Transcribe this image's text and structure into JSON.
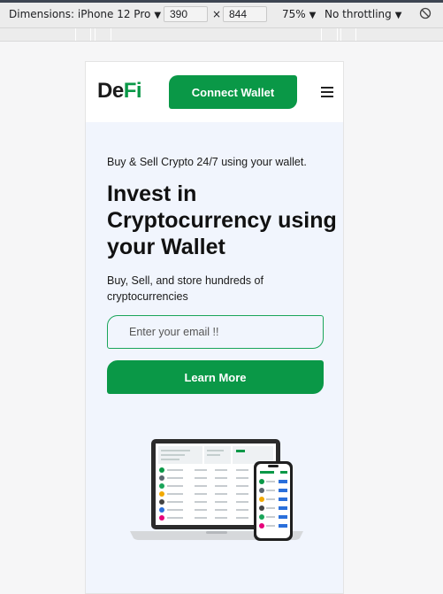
{
  "devtools": {
    "dimensions_label": "Dimensions: iPhone 12 Pro",
    "width_value": "390",
    "times": "×",
    "height_value": "844",
    "zoom": "75%",
    "throttling": "No throttling",
    "rotate_icon": "rotate-icon"
  },
  "nav": {
    "logo_de": "De",
    "logo_fi": "Fi",
    "connect_label": "Connect Wallet",
    "menu_icon": "hamburger-menu-icon"
  },
  "hero": {
    "tagline": "Buy & Sell Crypto 24/7 using your wallet.",
    "headline": "Invest in Cryptocurrency using your Wallet",
    "subtext": "Buy, Sell, and store hundreds of cryptocurrencies",
    "email_placeholder": "Enter your email !!",
    "learn_more_label": "Learn More",
    "illustration": "laptop-and-phone-dashboard-illustration"
  },
  "colors": {
    "brand_green": "#0a9847",
    "hero_bg": "#f1f5fd",
    "text_dark": "#111111"
  }
}
